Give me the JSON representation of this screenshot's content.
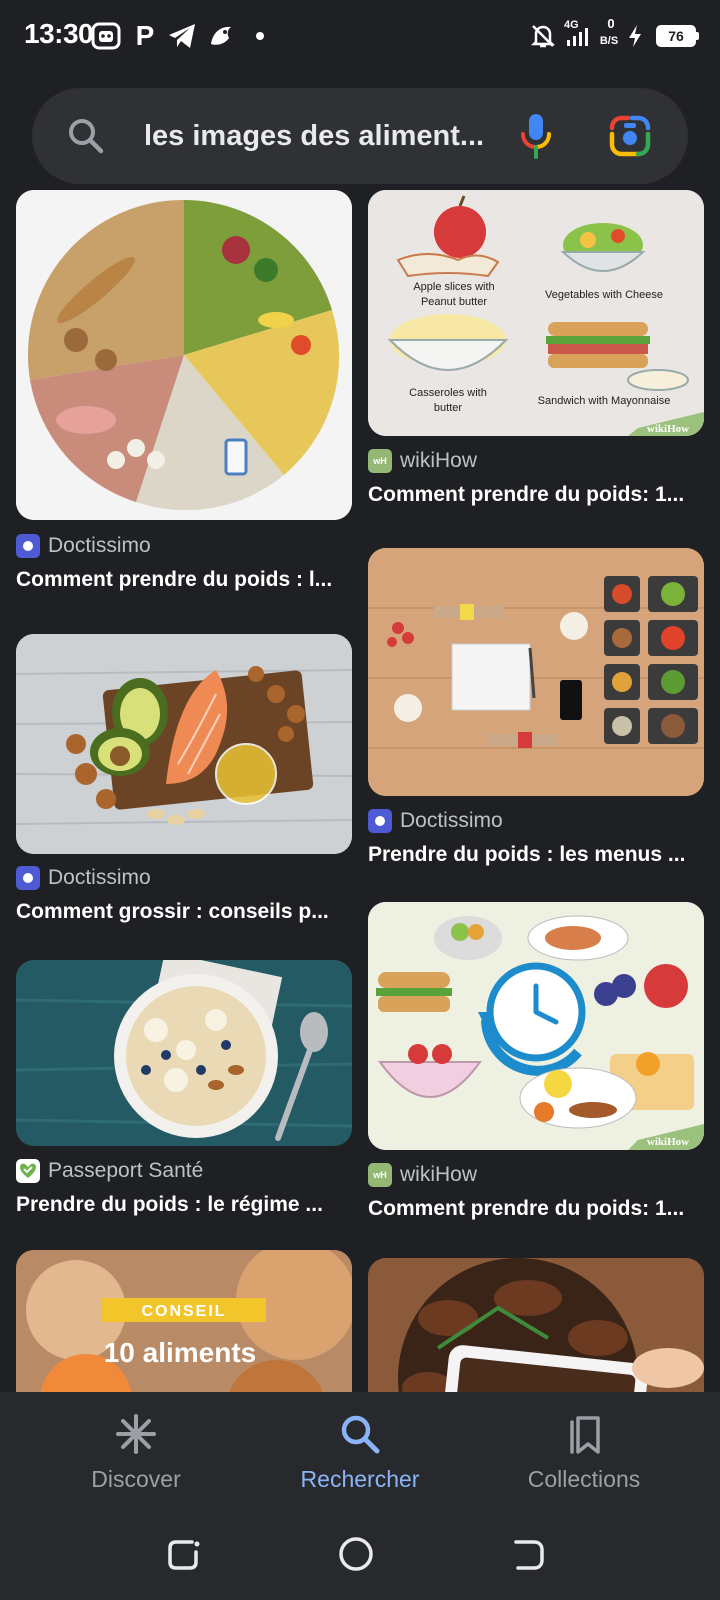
{
  "status_bar": {
    "time": "13:30",
    "p_label": "P",
    "network": "4G",
    "data_rate_value": "0",
    "data_rate_unit": "B/S",
    "battery": "76"
  },
  "search": {
    "query": "les images des aliment..."
  },
  "results": [
    {
      "source": "Doctissimo",
      "title": "Comment prendre du poids : l...",
      "favicon_color": "#4f5bd5"
    },
    {
      "source": "wikiHow",
      "title": "Comment prendre du poids: 1...",
      "favicon_color": "#93b874",
      "captions": [
        "Apple slices with",
        "Peanut butter",
        "Vegetables with Cheese",
        "Casseroles with",
        "butter",
        "Sandwich with Mayonnaise"
      ],
      "watermark": "wikiHow"
    },
    {
      "source": "Doctissimo",
      "title": "Comment grossir : conseils p...",
      "favicon_color": "#4f5bd5"
    },
    {
      "source": "Doctissimo",
      "title": "Prendre du poids : les menus ...",
      "favicon_color": "#4f5bd5"
    },
    {
      "source": "Passeport Santé",
      "title": "Prendre du poids : le régime ...",
      "favicon_color": "#6bb34a"
    },
    {
      "source": "wikiHow",
      "title": "Comment prendre du poids: 1...",
      "favicon_color": "#93b874",
      "watermark": "wikiHow"
    },
    {
      "overlay_tag": "CONSEIL",
      "overlay_title": "10 aliments"
    }
  ],
  "bottom_nav": {
    "items": [
      {
        "label": "Discover",
        "icon": "asterisk-icon",
        "active": false
      },
      {
        "label": "Rechercher",
        "icon": "search-icon",
        "active": true
      },
      {
        "label": "Collections",
        "icon": "collections-icon",
        "active": false
      }
    ]
  },
  "colors": {
    "background": "#1f2023",
    "search_bar": "#303134",
    "accent": "#8ab4f8",
    "muted": "#9aa0a6"
  }
}
